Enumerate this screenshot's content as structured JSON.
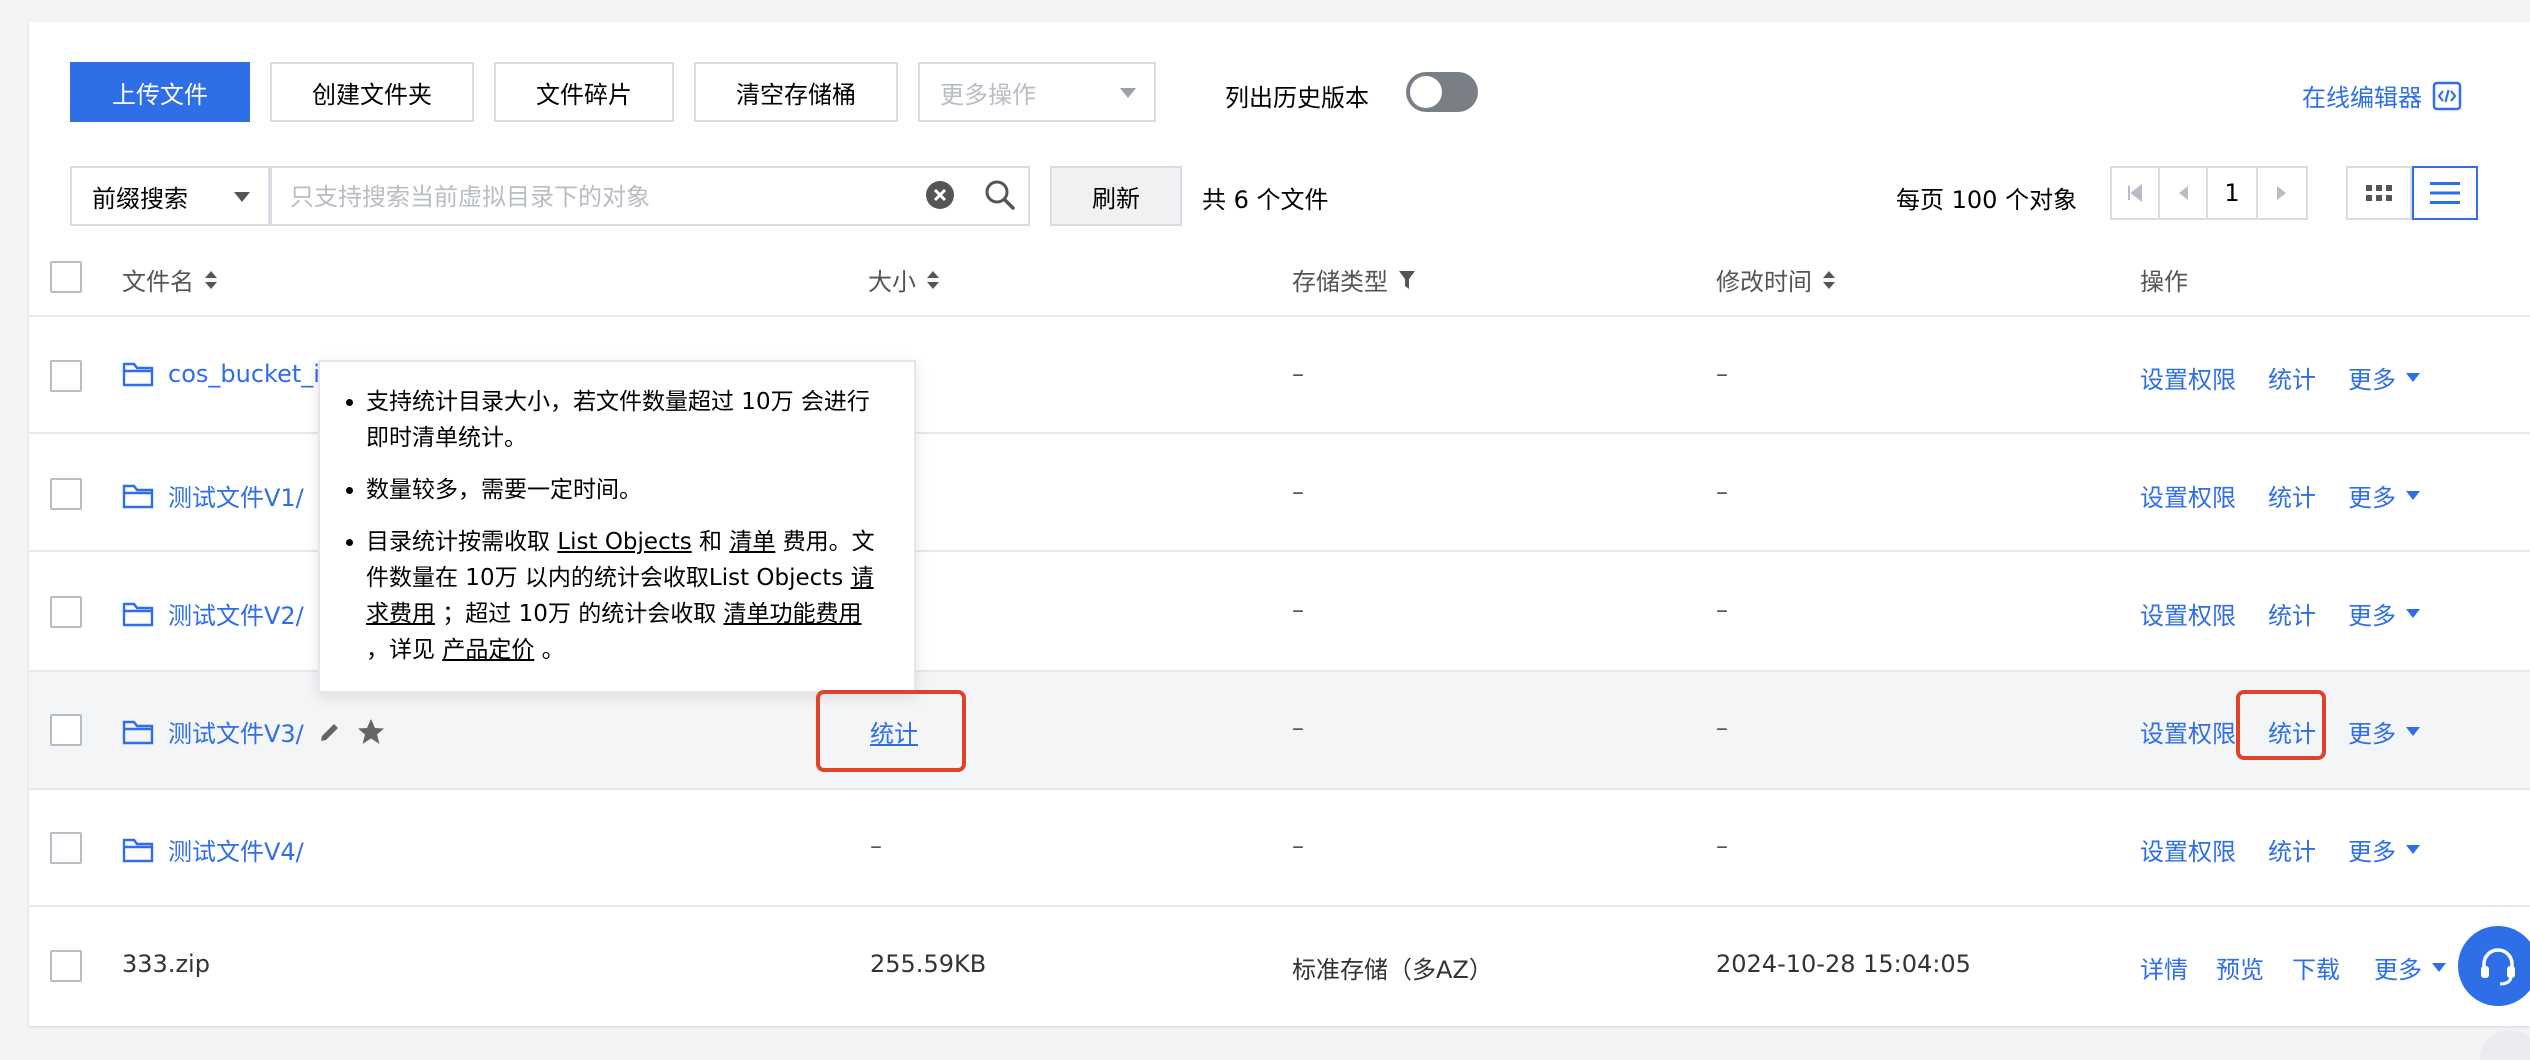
{
  "toolbar": {
    "upload": "上传文件",
    "create_folder": "创建文件夹",
    "fragments": "文件碎片",
    "clear_bucket": "清空存储桶",
    "more_ops": "更多操作",
    "history_label": "列出历史版本",
    "history_on": false,
    "online_editor": "在线编辑器"
  },
  "search": {
    "mode": "前缀搜索",
    "placeholder": "只支持搜索当前虚拟目录下的对象",
    "value": "",
    "refresh": "刷新",
    "total": "共 6 个文件"
  },
  "pagination": {
    "per_page": "每页 100 个对象",
    "current_page": "1"
  },
  "columns": {
    "name": "文件名",
    "size": "大小",
    "storage": "存储类型",
    "modified": "修改时间",
    "actions": "操作"
  },
  "rows": [
    {
      "name": "cos_bucket_i",
      "type": "folder",
      "size": "",
      "storage": "–",
      "modified": "–",
      "ops": [
        "设置权限",
        "统计",
        "更多"
      ]
    },
    {
      "name": "测试文件V1/",
      "type": "folder",
      "size": "",
      "storage": "–",
      "modified": "–",
      "ops": [
        "设置权限",
        "统计",
        "更多"
      ]
    },
    {
      "name": "测试文件V2/",
      "type": "folder",
      "size": "",
      "storage": "–",
      "modified": "–",
      "ops": [
        "设置权限",
        "统计",
        "更多"
      ]
    },
    {
      "name": "测试文件V3/",
      "type": "folder",
      "size": "统计",
      "storage": "–",
      "modified": "–",
      "ops": [
        "设置权限",
        "统计",
        "更多"
      ]
    },
    {
      "name": "测试文件V4/",
      "type": "folder",
      "size": "–",
      "storage": "–",
      "modified": "–",
      "ops": [
        "设置权限",
        "统计",
        "更多"
      ]
    },
    {
      "name": "333.zip",
      "type": "file",
      "size": "255.59KB",
      "storage": "标准存储（多AZ）",
      "modified": "2024-10-28 15:04:05",
      "ops": [
        "详情",
        "预览",
        "下载",
        "更多"
      ]
    }
  ],
  "tooltip": {
    "b1": "支持统计目录大小，若文件数量超过 10万 会进行即时清单统计。",
    "b2": "数量较多，需要一定时间。",
    "b3_p1": "目录统计按需收取 ",
    "b3_l1": "List Objects",
    "b3_p2": " 和 ",
    "b3_l2": "清单",
    "b3_p3": " 费用。文件数量在 10万 以内的统计会收取List Objects ",
    "b3_l3": "请求费用",
    "b3_p4": " ；超过 10万 的统计会收取 ",
    "b3_l4": "清单功能费用",
    "b3_p5": " ，详见 ",
    "b3_l5": "产品定价",
    "b3_p6": " 。"
  },
  "colors": {
    "accent": "#2e6ee6",
    "highlight": "#e0422a"
  }
}
